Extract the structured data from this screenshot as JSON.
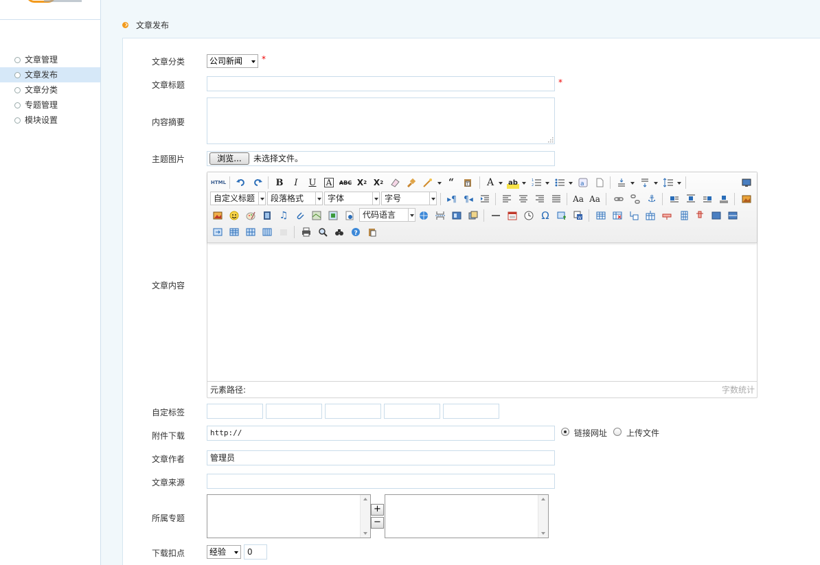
{
  "sidebar": {
    "items": [
      {
        "label": "文章管理"
      },
      {
        "label": "文章发布"
      },
      {
        "label": "文章分类"
      },
      {
        "label": "专题管理"
      },
      {
        "label": "模块设置"
      }
    ],
    "active_index": 1
  },
  "breadcrumb": {
    "label": "文章发布"
  },
  "form": {
    "category_label": "文章分类",
    "category_value": "公司新闻",
    "required_mark": "*",
    "title_label": "文章标题",
    "summary_label": "内容摘要",
    "image_label": "主题图片",
    "browse_label": "浏览...",
    "no_file_text": "未选择文件。",
    "content_label": "文章内容",
    "tags_label": "自定标签",
    "attachment_label": "附件下载",
    "attachment_value": "http://",
    "radio_link_label": "链接网址",
    "radio_upload_label": "上传文件",
    "author_label": "文章作者",
    "author_value": "管理员",
    "source_label": "文章来源",
    "topic_label": "所属专题",
    "plus_label": "+",
    "minus_label": "−",
    "deduct_label": "下载扣点",
    "deduct_type": "经验",
    "deduct_value": "0"
  },
  "editor": {
    "heading_select": "自定义标题",
    "paragraph_select": "段落格式",
    "font_select": "字体",
    "size_select": "字号",
    "code_select": "代码语言",
    "html_btn": "HTML",
    "path_label": "元素路径:",
    "word_count_label": "字数统计"
  },
  "colors": {
    "accent_orange": "#f29b1d",
    "sidebar_active": "#d6e8f8",
    "content_bg": "#f1f8fb",
    "required": "#ee0000"
  }
}
